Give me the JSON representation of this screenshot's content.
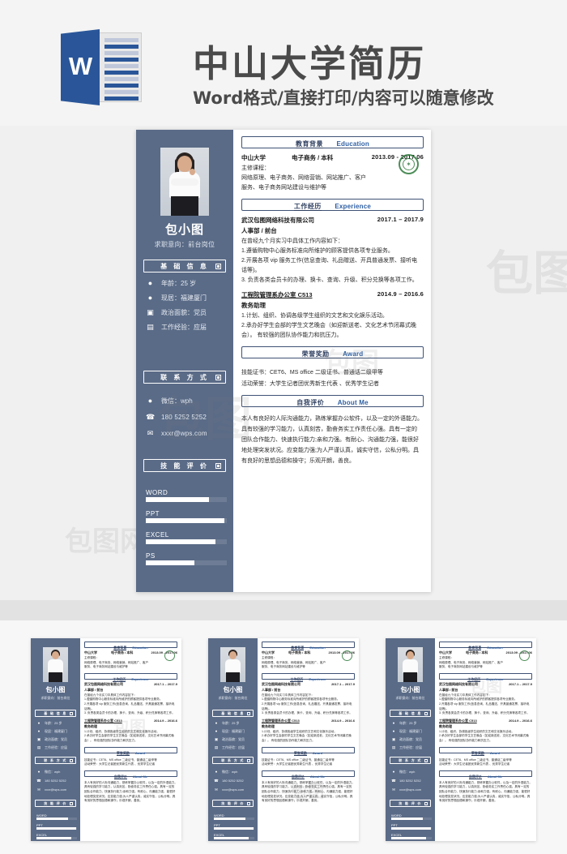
{
  "header": {
    "logo_letter": "W",
    "title": "中山大学简历",
    "subtitle": "Word格式/直接打印/内容可以随意修改"
  },
  "resume": {
    "sidebar": {
      "name": "包小图",
      "objective": "求职意向：前台岗位",
      "sections": [
        {
          "zh": "基 础 信 息",
          "icon": "square-icon"
        },
        {
          "zh": "联 系 方 式",
          "icon": "square-icon"
        },
        {
          "zh": "技 能 评 价",
          "icon": "square-icon"
        }
      ],
      "basic_info": [
        {
          "icon": "person-icon",
          "text": "年龄：25 岁"
        },
        {
          "icon": "location-icon",
          "text": "现居：福建厦门"
        },
        {
          "icon": "badge-icon",
          "text": "政治面貌：党员"
        },
        {
          "icon": "calendar-icon",
          "text": "工作经验：应届"
        }
      ],
      "contact": [
        {
          "icon": "wechat-icon",
          "text": "微信：wph"
        },
        {
          "icon": "phone-icon",
          "text": "180 5252 5252"
        },
        {
          "icon": "email-icon",
          "text": "xxxr@wps.com"
        }
      ],
      "skills": [
        {
          "label": "WORD",
          "percent": 78
        },
        {
          "label": "PPT",
          "percent": 97
        },
        {
          "label": "EXCEL",
          "percent": 86
        },
        {
          "label": "PS",
          "percent": 60
        }
      ]
    },
    "sections": {
      "education": {
        "zh": "教育背景",
        "en": "Education",
        "school": "中山大学",
        "major": "电子商务 / 本科",
        "dates": "2013.09 - 2017.06",
        "courses_label": "主修课程：",
        "courses_line1": "网络原理、电子商务、网络营销、网站推广、客户",
        "courses_line2": "服务、电子商务网站建设与维护等"
      },
      "experience": {
        "zh": "工作经历",
        "en": "Experience",
        "jobs": [
          {
            "company": "武汉包图网络科技有限公司",
            "dates": "2017.1 – 2017.9",
            "role": "人事部 / 前台",
            "lines": [
              "在曾经九个月实习中具体工作内容如下：",
              "1.遵循购物中心服务标准向所维护的顾客提供各项专业服务。",
              "2.开展各项 vip 服务工作(信息查询、礼品赠送、开具普通发票、接听电",
              "话等)。",
              "3. 负责各类会员卡的办理、换卡、查询、升级、积分兑换等各项工作。"
            ]
          },
          {
            "company": "工程院管理系办公室 C513",
            "dates": "2014.9 – 2016.6",
            "role": "教务助理",
            "lines": [
              "1.计划、组织、协调各级学生组织的文艺和文化娱乐活动。",
              "2.承办好学生会部的学生文艺晚会（如迎新送老、文化艺术节闭幕式晚",
              "会）。    有较强的团队协作能力和抗压力。"
            ]
          }
        ]
      },
      "award": {
        "zh": "荣誉奖励",
        "en": "Award",
        "lines": [
          "技能证书：CET6、MS office 二级证书、普通话二级甲等",
          "活动荣誉：大学生记者团优秀新生代表 、优秀学生记者"
        ]
      },
      "about": {
        "zh": "自我评价",
        "en": "About Me",
        "lines": [
          "本人有良好的人际沟通能力，熟练掌握办公软件，以及一定的外语能力。",
          "具有较强的学习能力，认真刻苦，勤奋务实工作责任心强。具有一定的",
          "团队合作能力、快速执行能力;亲和力强。有耐心、沟通能力强，能很好",
          "地处理突发状况。应变能力强;为人严谨认真，诚实守信，公私分明。具",
          "有良好的思想品德和操守；乐观开朗，善良。"
        ]
      }
    }
  },
  "thumbnails": {
    "count": 3,
    "items": [
      {
        "label": "resume-preview-1"
      },
      {
        "label": "resume-preview-2"
      },
      {
        "label": "resume-preview-3"
      }
    ]
  },
  "watermarks": {
    "text_big": "包图网",
    "text_small": "包图"
  },
  "colors": {
    "sidebar": "#5a6b87",
    "logo_blue": "#2a5699",
    "section_border": "#3f5275",
    "section_en": "#2e5fa3",
    "seal_green": "#2f7a3c"
  }
}
